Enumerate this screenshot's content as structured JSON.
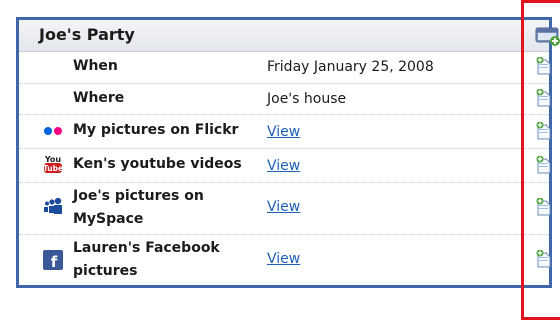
{
  "card": {
    "title": "Joe's Party"
  },
  "rows": [
    {
      "label": "When",
      "value": "Friday January 25, 2008",
      "icon": "none",
      "value_is_link": false
    },
    {
      "label": "Where",
      "value": "Joe's house",
      "icon": "none",
      "value_is_link": false
    },
    {
      "label": "My pictures on Flickr",
      "value": "View",
      "icon": "flickr-icon",
      "value_is_link": true
    },
    {
      "label": "Ken's youtube videos",
      "value": "View",
      "icon": "youtube-icon",
      "value_is_link": true
    },
    {
      "label": "Joe's pictures on MySpace",
      "value": "View",
      "icon": "myspace-icon",
      "value_is_link": true
    },
    {
      "label": "Lauren's Facebook pictures",
      "value": "View",
      "icon": "facebook-icon",
      "value_is_link": true
    }
  ],
  "icons": {
    "header_action": "add-window-icon",
    "row_action": "add-note-icon"
  },
  "colors": {
    "card_border": "#3f67a8",
    "link": "#1f5fb8",
    "highlight_box": "#e0141e"
  }
}
